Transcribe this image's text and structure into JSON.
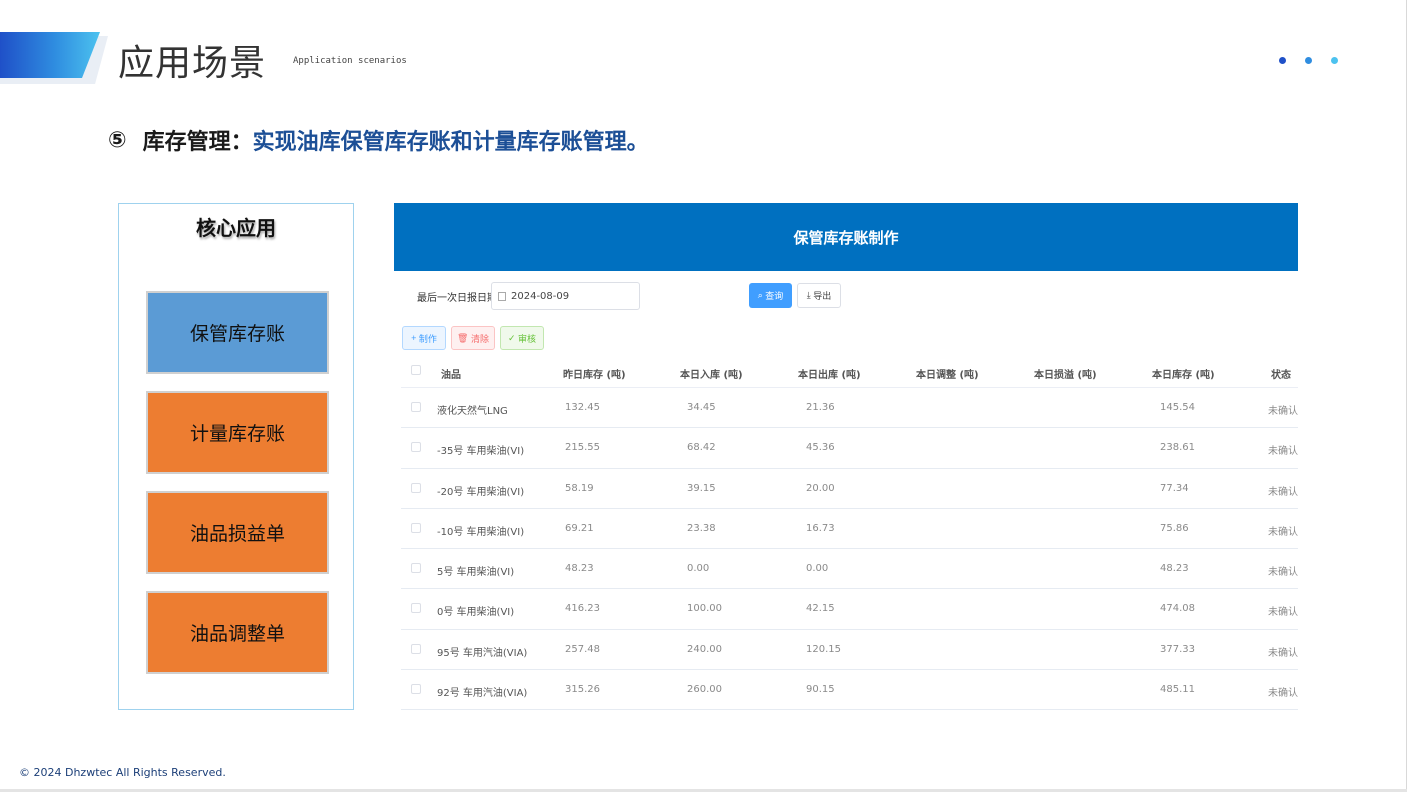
{
  "header": {
    "title": "应用场景",
    "subtitle": "Application scenarios",
    "dot_colors": [
      "#1f50c8",
      "#2f8de0",
      "#4cc2ef"
    ]
  },
  "heading": {
    "number": "⑤",
    "label": "库存管理：",
    "description": "实现油库保管库存账和计量库存账管理。"
  },
  "core_panel": {
    "title": "核心应用",
    "items": [
      {
        "label": "保管库存账",
        "color": "#5b9bd5"
      },
      {
        "label": "计量库存账",
        "color": "#ed7d31"
      },
      {
        "label": "油品损益单",
        "color": "#ed7d31"
      },
      {
        "label": "油品调整单",
        "color": "#ed7d31"
      }
    ]
  },
  "window": {
    "title": "保管库存账制作",
    "filter_label": "最后一次日报日期",
    "date_value": "2024-08-09",
    "query_label": "查询",
    "export_label": "导出",
    "make_label": "制作",
    "clear_label": "清除",
    "audit_label": "审核"
  },
  "table": {
    "columns": [
      "油品",
      "昨日库存 (吨)",
      "本日入库 (吨)",
      "本日出库 (吨)",
      "本日调整 (吨)",
      "本日损溢 (吨)",
      "本日库存 (吨)",
      "状态"
    ],
    "rows": [
      {
        "name": "液化天然气LNG",
        "yesterday": "132.45",
        "in": "34.45",
        "out": "21.36",
        "adjust": "",
        "loss": "",
        "today": "145.54",
        "status": "未确认"
      },
      {
        "name": "-35号 车用柴油(VI)",
        "yesterday": "215.55",
        "in": "68.42",
        "out": "45.36",
        "adjust": "",
        "loss": "",
        "today": "238.61",
        "status": "未确认"
      },
      {
        "name": "-20号 车用柴油(VI)",
        "yesterday": "58.19",
        "in": "39.15",
        "out": "20.00",
        "adjust": "",
        "loss": "",
        "today": "77.34",
        "status": "未确认"
      },
      {
        "name": "-10号 车用柴油(VI)",
        "yesterday": "69.21",
        "in": "23.38",
        "out": "16.73",
        "adjust": "",
        "loss": "",
        "today": "75.86",
        "status": "未确认"
      },
      {
        "name": "5号 车用柴油(VI)",
        "yesterday": "48.23",
        "in": "0.00",
        "out": "0.00",
        "adjust": "",
        "loss": "",
        "today": "48.23",
        "status": "未确认"
      },
      {
        "name": "0号 车用柴油(VI)",
        "yesterday": "416.23",
        "in": "100.00",
        "out": "42.15",
        "adjust": "",
        "loss": "",
        "today": "474.08",
        "status": "未确认"
      },
      {
        "name": "95号 车用汽油(VIA)",
        "yesterday": "257.48",
        "in": "240.00",
        "out": "120.15",
        "adjust": "",
        "loss": "",
        "today": "377.33",
        "status": "未确认"
      },
      {
        "name": "92号 车用汽油(VIA)",
        "yesterday": "315.26",
        "in": "260.00",
        "out": "90.15",
        "adjust": "",
        "loss": "",
        "today": "485.11",
        "status": "未确认"
      }
    ]
  },
  "footer": {
    "copyright": "© 2024  Dhzwtec All Rights Reserved."
  }
}
